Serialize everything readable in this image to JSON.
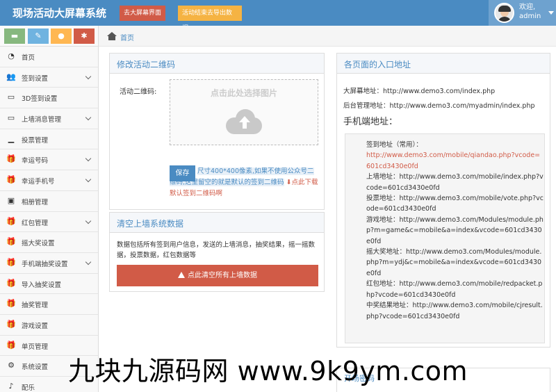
{
  "header": {
    "title": "现场活动大屏幕系统",
    "btn_big_screen": "去大屏幕界面",
    "btn_export": "活动结束去导出数据",
    "welcome": "欢迎,",
    "username": "admin"
  },
  "sidebar": {
    "items": [
      {
        "label": "首页",
        "icon": "tachometer-icon",
        "glyph": "◔"
      },
      {
        "label": "签到设置",
        "icon": "users-icon",
        "glyph": "👥"
      },
      {
        "label": "3D签到设置",
        "icon": "desktop-icon",
        "glyph": "▭"
      },
      {
        "label": "上墙消息管理",
        "icon": "desktop-icon",
        "glyph": "▭"
      },
      {
        "label": "投票管理",
        "icon": "signal-icon",
        "glyph": "▁"
      },
      {
        "label": "幸运号码",
        "icon": "gift-icon",
        "glyph": "🎁"
      },
      {
        "label": "幸运手机号",
        "icon": "gift-icon",
        "glyph": "🎁"
      },
      {
        "label": "相册管理",
        "icon": "picture-icon",
        "glyph": "▣"
      },
      {
        "label": "红包管理",
        "icon": "gift-icon",
        "glyph": "🎁"
      },
      {
        "label": "摇大奖设置",
        "icon": "gift-icon",
        "glyph": "🎁"
      },
      {
        "label": "手机端抽奖设置",
        "icon": "gift-icon",
        "glyph": "🎁"
      },
      {
        "label": "导入抽奖设置",
        "icon": "gift-icon",
        "glyph": "🎁"
      },
      {
        "label": "抽奖管理",
        "icon": "gift-icon",
        "glyph": "🎁"
      },
      {
        "label": "游戏设置",
        "icon": "gift-icon",
        "glyph": "🎁"
      },
      {
        "label": "单页管理",
        "icon": "gift-icon",
        "glyph": "🎁"
      },
      {
        "label": "系统设置",
        "icon": "gear-icon",
        "glyph": "⚙"
      },
      {
        "label": "配乐",
        "icon": "music-icon",
        "glyph": "♪"
      }
    ]
  },
  "breadcrumb": {
    "home": "首页"
  },
  "qr_panel": {
    "title": "修改活动二维码",
    "label": "活动二维码:",
    "upload_text": "点击此处选择图片",
    "save": "保存",
    "hint_blue": "尺寸400*400像素,如果不使用公众号二维码,这里留空的就是默认的签到二维码",
    "hint_red": "点此下载默认签到二维码啊"
  },
  "clear_panel": {
    "title": "清空上墙系统数据",
    "desc": "数据包括所有签到用户信息，发送的上墙消息，抽奖结果，摇一摇数据，投票数据，红包数据等",
    "button": "点此清空所有上墙数据"
  },
  "address_panel": {
    "title": "各页面的入口地址",
    "big_screen": "大屏幕地址：http://www.demo3.com/index.php",
    "admin": "后台管理地址：http://www.demo3.com/myadmin/index.php",
    "mobile_title": "手机端地址：",
    "lines": [
      {
        "text": "签到地址（常用）：",
        "red": false
      },
      {
        "text": "http://www.demo3.com/mobile/qiandao.php?vcode=601cd3430e0fd",
        "red": true
      },
      {
        "text": "上墙地址：http://www.demo3.com/mobile/index.php?vcode=601cd3430e0fd",
        "red": false
      },
      {
        "text": "投票地址：http://www.demo3.com/mobile/vote.php?vcode=601cd3430e0fd",
        "red": false
      },
      {
        "text": "游戏地址：http://www.demo3.com/Modules/module.php?m=game&c=mobile&a=index&vcode=601cd3430e0fd",
        "red": false
      },
      {
        "text": "摇大奖地址：http://www.demo3.com/Modules/module.php?m=ydj&c=mobile&a=index&vcode=601cd3430e0fd",
        "red": false
      },
      {
        "text": "红包地址：http://www.demo3.com/mobile/redpacket.php?vcode=601cd3430e0fd",
        "red": false
      },
      {
        "text": "中奖结果地址：http://www.demo3.com/mobile/cjresult.php?vcode=601cd3430e0fd",
        "red": false
      }
    ]
  },
  "bottom_panel": {
    "title": "开场密码"
  },
  "watermark": "九块九源码网 www.9k9ym.com"
}
